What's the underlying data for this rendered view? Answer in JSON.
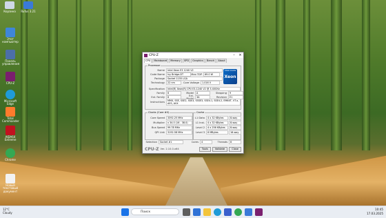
{
  "desktop": {
    "top_icons": [
      {
        "label": "Корзина",
        "color": "#cfd8e6"
      },
      {
        "label": "Rufus 3.21",
        "color": "#3a7ad8"
      }
    ],
    "icons": [
      {
        "label": "Этот компьютер",
        "color": "#3f86d8"
      },
      {
        "label": "Панель управления",
        "color": "#4c6fa8"
      },
      {
        "label": "CPU-Z",
        "color": "#7a1f6e"
      },
      {
        "label": "Microsoft Edge",
        "color": "#1f9bd8"
      },
      {
        "label": "Total Commander",
        "color": "#ff7b2c"
      },
      {
        "label": "AIDA64 Extreme",
        "color": "#c1121f"
      },
      {
        "label": "Chrome",
        "color": "#34a853"
      },
      {
        "label": "Новый текстовый документ",
        "color": "#f2f2f2"
      }
    ]
  },
  "cpuz": {
    "title": "CPU-Z",
    "tabs": [
      "CPU",
      "Mainboard",
      "Memory",
      "SPD",
      "Graphics",
      "Bench",
      "About"
    ],
    "processor_legend": "Processor",
    "name_label": "Name",
    "name_value": "Intel Xeon E3 1240 V2",
    "codename_label": "Code Name",
    "codename_value": "Ivy Bridge-DT",
    "maxtdp_label": "Max TDP",
    "maxtdp_value": "69.0 W",
    "package_label": "Package",
    "package_value": "Socket 1155 LGA",
    "tech_label": "Technology",
    "tech_value": "22 nm",
    "voltage_label": "Core Voltage",
    "voltage_value": "1.016 V",
    "spec_label": "Specification",
    "spec_value": "Intel(R) Xeon(R) CPU E3-1240 V2 @ 3.40GHz",
    "family_label": "Family",
    "family_value": "6",
    "model_label": "Model",
    "model_value": "A",
    "stepping_label": "Stepping",
    "stepping_value": "9",
    "extfamily_label": "Ext. Family",
    "extfamily_value": "6",
    "extmodel_label": "Ext. Model",
    "extmodel_value": "3A",
    "revision_label": "Revision",
    "revision_value": "E1",
    "instr_label": "Instructions",
    "instr_value": "MMX, SSE, SSE2, SSE3, SSSE3, SSE4.1, SSE4.2, EM64T, VT-x, AES, AVX",
    "xeon_badge": "intel inside",
    "xeon_word": "Xeon",
    "clocks_legend": "Clocks (Core #0)",
    "corespeed_label": "Core Speed",
    "corespeed_value": "3392.25 MHz",
    "multiplier_label": "Multiplier",
    "multiplier_value": "x 34.0 (16 - 38.0)",
    "busspeed_label": "Bus Speed",
    "busspeed_value": "99.78 MHz",
    "qpi_label": "QPI Link",
    "qpi_value": "3192.58 MHz",
    "cache_legend": "Cache",
    "l1d_label": "L1 Data",
    "l1d_value": "4 x 32 KBytes",
    "l1d_way": "8-way",
    "l1i_label": "L1 Inst.",
    "l1i_value": "4 x 32 KBytes",
    "l1i_way": "8-way",
    "l2_label": "Level 2",
    "l2_value": "4 x 256 KBytes",
    "l2_way": "8-way",
    "l3_label": "Level 3",
    "l3_value": "8 MBytes",
    "l3_way": "16-way",
    "selection_label": "Selection",
    "selection_value": "Socket #1",
    "cores_label": "Cores",
    "cores_value": "4",
    "threads_label": "Threads",
    "threads_value": "8",
    "version": "Ver. 2.10.0.x64",
    "tools_label": "Tools",
    "validate_label": "Validate",
    "close_label": "Close"
  },
  "taskbar": {
    "weather_temp": "12°C",
    "weather_desc": "Cloudy",
    "search_placeholder": "Поиск",
    "time": "10:45",
    "date": "17.03.2025"
  }
}
